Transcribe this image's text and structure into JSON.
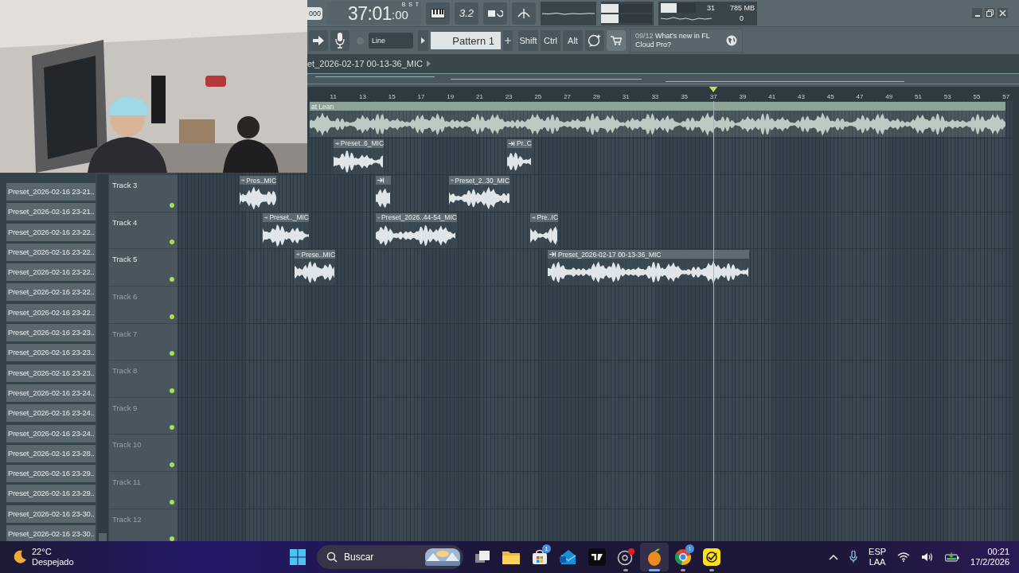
{
  "toolbar": {
    "tempo": "000",
    "time": "37:01",
    "time_ticks": ":00",
    "time_units": "B S T",
    "countdown": "3.2",
    "sliders": [
      {
        "level": 0.15
      },
      {
        "level": 0.15
      }
    ],
    "cpu": {
      "level": 0.45,
      "polyphony": "31",
      "memory": "785 MB",
      "voices": "0"
    }
  },
  "transport": {
    "line_mode": "Line",
    "pattern": "Pattern 1",
    "modifiers": [
      "Shift",
      "Ctrl",
      "Alt"
    ],
    "news_counter": "09/12",
    "news_text": "What's new in FL Cloud Pro?"
  },
  "playlist": {
    "title": "et_2026-02-17 00-13-36_MIC",
    "ruler": [
      "11",
      "13",
      "15",
      "17",
      "19",
      "21",
      "23",
      "25",
      "27",
      "29",
      "31",
      "33",
      "35",
      "37",
      "39",
      "41",
      "43",
      "45",
      "47",
      "49",
      "51",
      "53",
      "55",
      "57"
    ],
    "tracks": [
      {
        "clips": [
          {
            "name": "at Lean",
            "selected": true
          }
        ]
      },
      {
        "clips": [
          {
            "name": "Preset..6_MIC",
            "selected": false
          },
          {
            "name": "Pr..C",
            "selected": false
          }
        ]
      },
      {
        "name": "Track 3",
        "dimmed": false,
        "muted": false,
        "clips": [
          {
            "name": "Pres..MIC",
            "selected": false
          },
          {
            "selected": false
          },
          {
            "name": "Preset_2..30_MIC",
            "selected": false
          }
        ]
      },
      {
        "name": "Track 4",
        "dimmed": false,
        "muted": false,
        "clips": [
          {
            "name": "Preset.._MIC",
            "selected": false
          },
          {
            "name": "Preset_2026..44-54_MIC",
            "selected": false
          },
          {
            "name": "Pre..IC",
            "selected": false
          }
        ]
      },
      {
        "name": "Track 5",
        "dimmed": false,
        "muted": false,
        "clips": [
          {
            "name": "Prese..MIC",
            "selected": false
          },
          {
            "name": "Preset_2026-02-17 00-13-36_MIC",
            "selected": false
          }
        ]
      },
      {
        "name": "Track 6",
        "dimmed": true,
        "muted": false
      },
      {
        "name": "Track 7",
        "dimmed": true,
        "muted": false
      },
      {
        "name": "Track 8",
        "dimmed": true,
        "muted": false
      },
      {
        "name": "Track 9",
        "dimmed": true,
        "muted": false
      },
      {
        "name": "Track 10",
        "dimmed": true,
        "muted": false
      },
      {
        "name": "Track 11",
        "dimmed": true,
        "muted": false
      },
      {
        "name": "Track 12",
        "dimmed": true,
        "muted": false
      }
    ]
  },
  "browser": {
    "items": [
      "Preset_2026-02-16 23-21..",
      "Preset_2026-02-16 23-21..",
      "Preset_2026-02-16 23-22..",
      "Preset_2026-02-16 23-22..",
      "Preset_2026-02-16 23-22..",
      "Preset_2026-02-16 23-22..",
      "Preset_2026-02-16 23-22..",
      "Preset_2026-02-16 23-23..",
      "Preset_2026-02-16 23-23..",
      "Preset_2026-02-16 23-23..",
      "Preset_2026-02-16 23-24..",
      "Preset_2026-02-16 23-24..",
      "Preset_2026-02-16 23-24..",
      "Preset_2026-02-16 23-28..",
      "Preset_2026-02-16 23-29..",
      "Preset_2026-02-16 23-29..",
      "Preset_2026-02-16 23-30..",
      "Preset_2026-02-16 23-30.."
    ]
  },
  "taskbar": {
    "temperature": "22°C",
    "weather": "Despejado",
    "search_placeholder": "Buscar",
    "apps": [
      {
        "kind": "task-view",
        "selected": false,
        "running": false
      },
      {
        "kind": "folder",
        "selected": false,
        "running": false
      },
      {
        "kind": "store",
        "selected": false,
        "running": false,
        "badge": "1"
      },
      {
        "kind": "mail",
        "selected": false,
        "running": false
      },
      {
        "kind": "chart",
        "selected": false,
        "running": false
      },
      {
        "kind": "recorder",
        "selected": false,
        "running": true
      },
      {
        "kind": "daw",
        "selected": true,
        "running": true
      },
      {
        "kind": "browser",
        "selected": false,
        "running": true,
        "badge": "!"
      },
      {
        "kind": "check",
        "selected": false,
        "running": true
      }
    ],
    "language": "ESP",
    "layout": "LAA",
    "time": "00:21",
    "date": "17/2/2026"
  }
}
